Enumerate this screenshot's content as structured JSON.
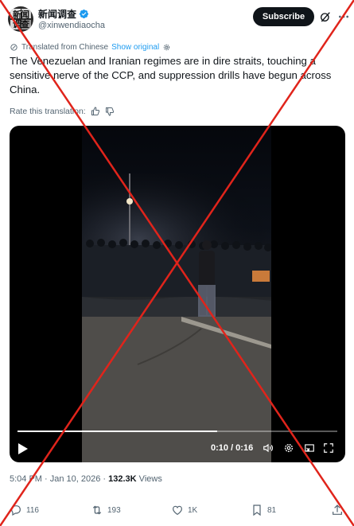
{
  "author": {
    "display_name": "新闻调查",
    "handle": "@xinwendiaocha",
    "avatar_text": "新闻调查"
  },
  "header": {
    "subscribe_label": "Subscribe",
    "grok_icon": "grok-icon",
    "more_icon": "more-icon"
  },
  "translation": {
    "translated_label": "Translated from Chinese",
    "show_original_label": "Show original",
    "rate_label": "Rate this translation:"
  },
  "post": {
    "text": "The Venezuelan and Iranian regimes are in dire straits, touching a sensitive nerve of the CCP, and suppression drills have begun across China."
  },
  "video": {
    "time": "0:10 / 0:16",
    "progress": 0.625
  },
  "meta": {
    "timestamp": "5:04 PM · Jan 10, 2026 · ",
    "views_count": "132.3K",
    "views_label": " Views"
  },
  "actions": {
    "replies": "116",
    "reposts": "193",
    "likes": "1K",
    "bookmarks": "81"
  },
  "colors": {
    "accent": "#1d9bf0",
    "text_secondary": "#536471",
    "overlay_red": "#e0241b"
  }
}
